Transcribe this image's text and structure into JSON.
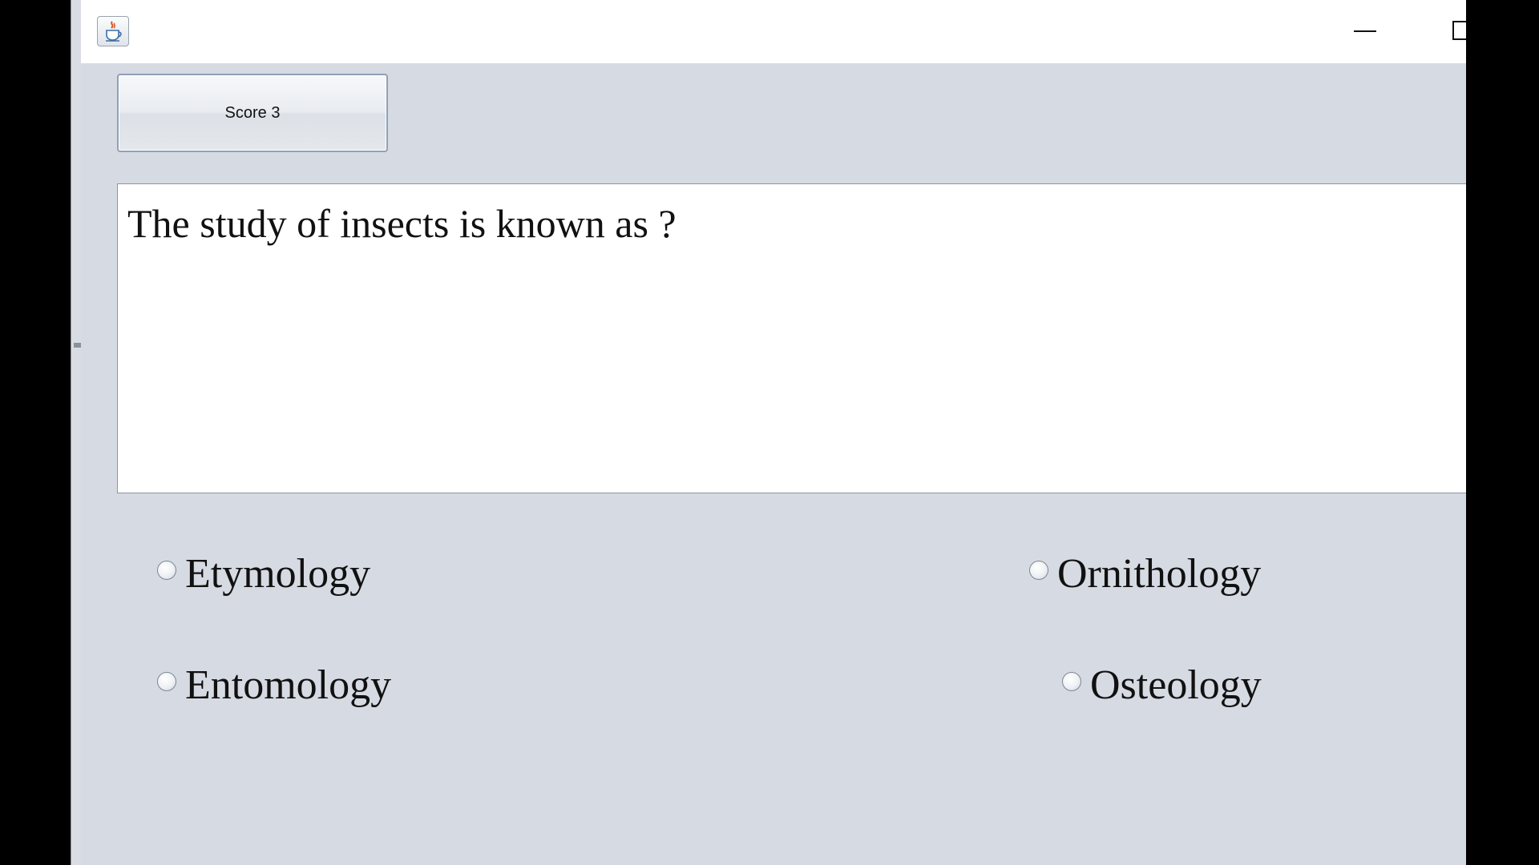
{
  "window": {
    "icon": "java-cup-icon",
    "controls": [
      "minimize-icon",
      "maximize-icon"
    ]
  },
  "score": {
    "label": "Score 3"
  },
  "question": {
    "text": "The study of insects is known as ?"
  },
  "options": [
    {
      "label": "Etymology",
      "selected": false
    },
    {
      "label": "Ornithology",
      "selected": false
    },
    {
      "label": "Entomology",
      "selected": false
    },
    {
      "label": "Osteology",
      "selected": false
    }
  ],
  "colors": {
    "window_background": "#d6dae2",
    "titlebar": "#ffffff",
    "question_background": "#ffffff",
    "button_border": "#8fa1b7"
  }
}
